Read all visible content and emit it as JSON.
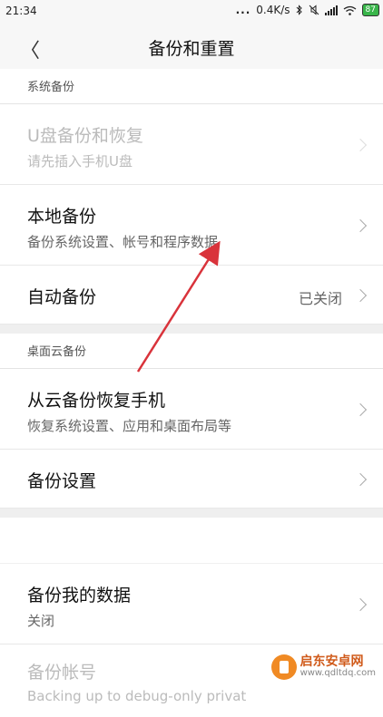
{
  "status_bar": {
    "time": "21:34",
    "dots": "...",
    "speed": "0.4K/s",
    "battery": "87"
  },
  "header": {
    "back_glyph": "〈",
    "title": "备份和重置"
  },
  "sections": {
    "system_backup": {
      "title": "系统备份",
      "usb": {
        "title": "U盘备份和恢复",
        "sub": "请先插入手机U盘",
        "enabled": false
      },
      "local": {
        "title": "本地备份",
        "sub": "备份系统设置、帐号和程序数据"
      },
      "auto": {
        "title": "自动备份",
        "value": "已关闭"
      }
    },
    "desktop_cloud_backup": {
      "title": "桌面云备份",
      "restore": {
        "title": "从云备份恢复手机",
        "sub": "恢复系统设置、应用和桌面布局等"
      },
      "settings": {
        "title": "备份设置"
      }
    },
    "other": {
      "my_data": {
        "title": "备份我的数据",
        "sub": "关闭"
      },
      "account": {
        "title": "备份帐号",
        "sub": "Backing up to debug-only privat"
      }
    }
  },
  "watermark": {
    "main": "启东安卓网",
    "url": "www.qdltdq.com"
  },
  "colors": {
    "arrow": "#d9333b",
    "battery": "#39b54a",
    "watermark": "#f08a24"
  }
}
